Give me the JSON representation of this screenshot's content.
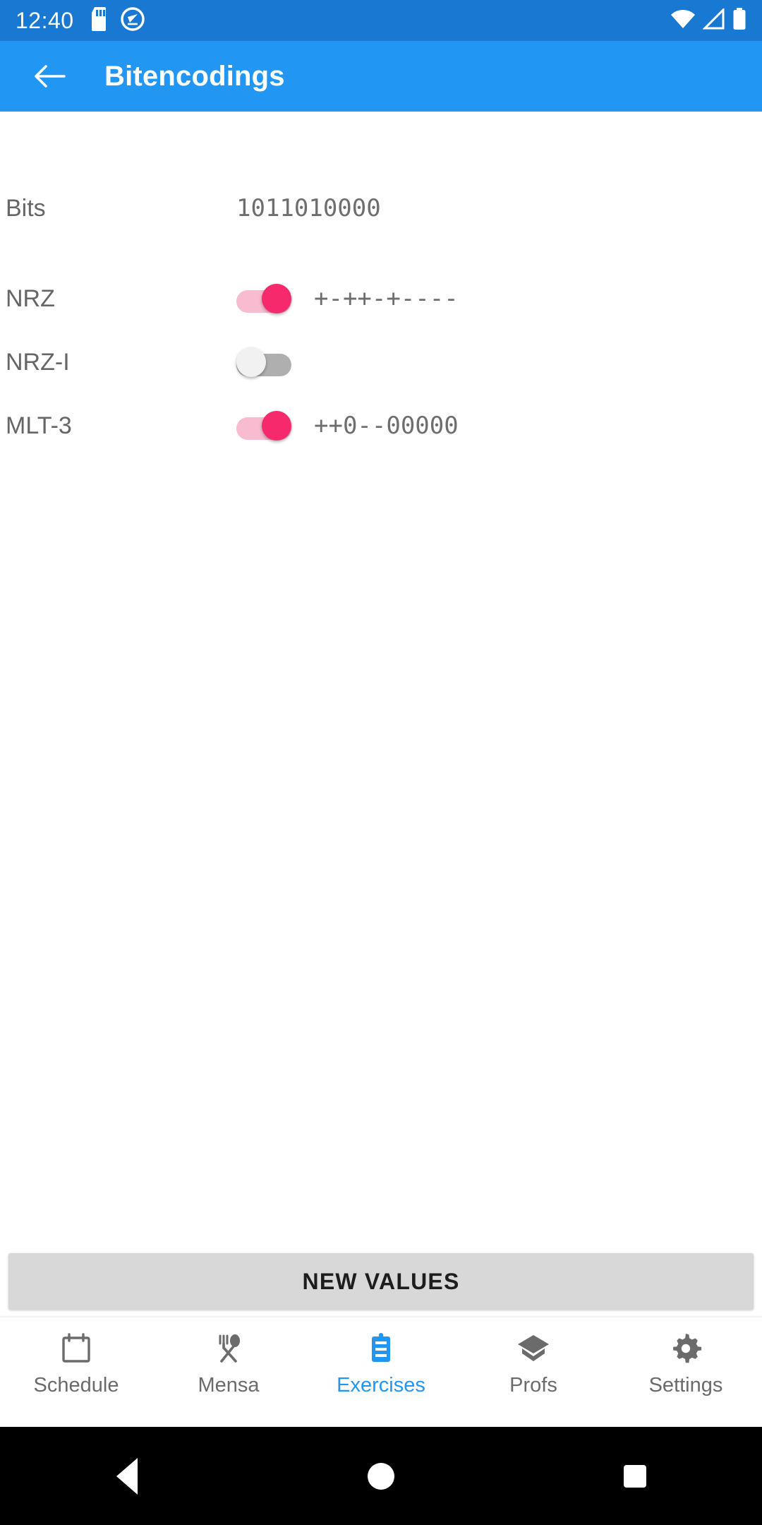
{
  "status_bar": {
    "time": "12:40",
    "left_icons": [
      "sd-card-icon",
      "screen-capture-circle-icon"
    ],
    "right_icons": [
      "wifi-icon",
      "cell-signal-icon",
      "battery-icon"
    ],
    "background_color": "#1878D2"
  },
  "app_bar": {
    "back_label": "back-arrow-icon",
    "title": "Bitencodings",
    "background_color": "#2196F3"
  },
  "encodings": {
    "bits_row": {
      "label": "Bits",
      "value": "1011010000"
    },
    "rows": [
      {
        "label": "NRZ",
        "enabled": true,
        "value": "+-++-+----"
      },
      {
        "label": "NRZ-I",
        "enabled": false,
        "value": ""
      },
      {
        "label": "MLT-3",
        "enabled": true,
        "value": "++0--00000"
      }
    ],
    "toggle_on_color": "#F5296B",
    "toggle_on_track_color": "#F8BBD0",
    "toggle_off_color": "#F1F1F1",
    "toggle_off_track_color": "#AFAFAF"
  },
  "action_button": {
    "label": "NEW VALUES"
  },
  "bottom_nav": {
    "active_index": 2,
    "active_color": "#2196F3",
    "inactive_color": "#6b6b6b",
    "items": [
      {
        "label": "Schedule",
        "icon": "calendar-icon"
      },
      {
        "label": "Mensa",
        "icon": "fork-spoon-icon"
      },
      {
        "label": "Exercises",
        "icon": "clipboard-icon"
      },
      {
        "label": "Profs",
        "icon": "graduation-cap-icon"
      },
      {
        "label": "Settings",
        "icon": "gear-icon"
      }
    ]
  },
  "system_nav": {
    "back": "system-back-icon",
    "home": "system-home-icon",
    "recents": "system-recents-icon"
  }
}
